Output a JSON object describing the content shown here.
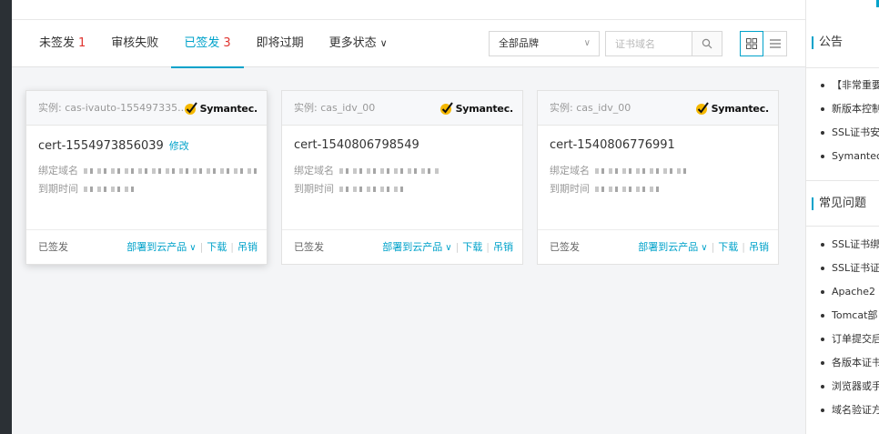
{
  "tabs": [
    {
      "label": "未签发",
      "count": "1",
      "active": false,
      "chevron": false
    },
    {
      "label": "审核失败",
      "count": "",
      "active": false,
      "chevron": false
    },
    {
      "label": "已签发",
      "count": "3",
      "active": true,
      "chevron": false
    },
    {
      "label": "即将过期",
      "count": "",
      "active": false,
      "chevron": false
    },
    {
      "label": "更多状态",
      "count": "",
      "active": false,
      "chevron": true
    }
  ],
  "filters": {
    "brand_select": "全部品牌",
    "search_placeholder": "证书域名"
  },
  "cards": [
    {
      "instance": "实例: cas-ivauto-155497335...",
      "brand": "Symantec.",
      "cert_name": "cert-1554973856039",
      "edit_label": "修改",
      "domain_label": "绑定域名",
      "expire_label": "到期时间",
      "status": "已签发",
      "deploy_label": "部署到云产品",
      "download_label": "下载",
      "revoke_label": "吊销"
    },
    {
      "instance": "实例: cas_idv_00",
      "brand": "Symantec.",
      "cert_name": "cert-1540806798549",
      "edit_label": "",
      "domain_label": "绑定域名",
      "expire_label": "到期时间",
      "status": "已签发",
      "deploy_label": "部署到云产品",
      "download_label": "下载",
      "revoke_label": "吊销"
    },
    {
      "instance": "实例: cas_idv_00",
      "brand": "Symantec.",
      "cert_name": "cert-1540806776991",
      "edit_label": "",
      "domain_label": "绑定域名",
      "expire_label": "到期时间",
      "status": "已签发",
      "deploy_label": "部署到云产品",
      "download_label": "下载",
      "revoke_label": "吊销"
    }
  ],
  "sidebar": {
    "announcements_title": "公告",
    "announcements": [
      "【非常重要",
      "新版本控制",
      "SSL证书安",
      "Symantec"
    ],
    "faq_title": "常见问题",
    "faq": [
      "SSL证书绑",
      "SSL证书证",
      "Apache2",
      "Tomcat部",
      "订单提交后",
      "各版本证书",
      "浏览器或手",
      "域名验证方"
    ]
  },
  "colors": {
    "accent": "#00a2ca",
    "count_red": "#e0342f",
    "symantec_check": "#f5b800"
  }
}
